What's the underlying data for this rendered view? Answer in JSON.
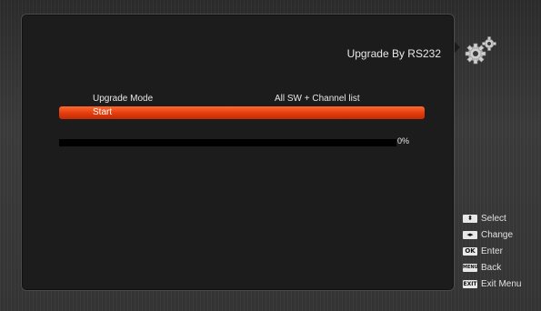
{
  "header": {
    "title": "Upgrade By RS232"
  },
  "settings": {
    "mode_label": "Upgrade Mode",
    "mode_value": "All SW + Channel list",
    "start_label": "Start"
  },
  "progress": {
    "value": 0,
    "text": "0%"
  },
  "help": [
    {
      "key": "⬍",
      "label": "Select",
      "icon": "up-down-arrows-key-icon"
    },
    {
      "key": "◂▸",
      "label": "Change",
      "icon": "left-right-arrows-key-icon"
    },
    {
      "key": "OK",
      "label": "Enter",
      "icon": "ok-key-icon"
    },
    {
      "key": "MENU",
      "label": "Back",
      "icon": "menu-key-icon"
    },
    {
      "key": "EXIT",
      "label": "Exit Menu",
      "icon": "exit-key-icon"
    }
  ],
  "colors": {
    "highlight": "#e23a0c",
    "panel": "#1c1c1c"
  }
}
